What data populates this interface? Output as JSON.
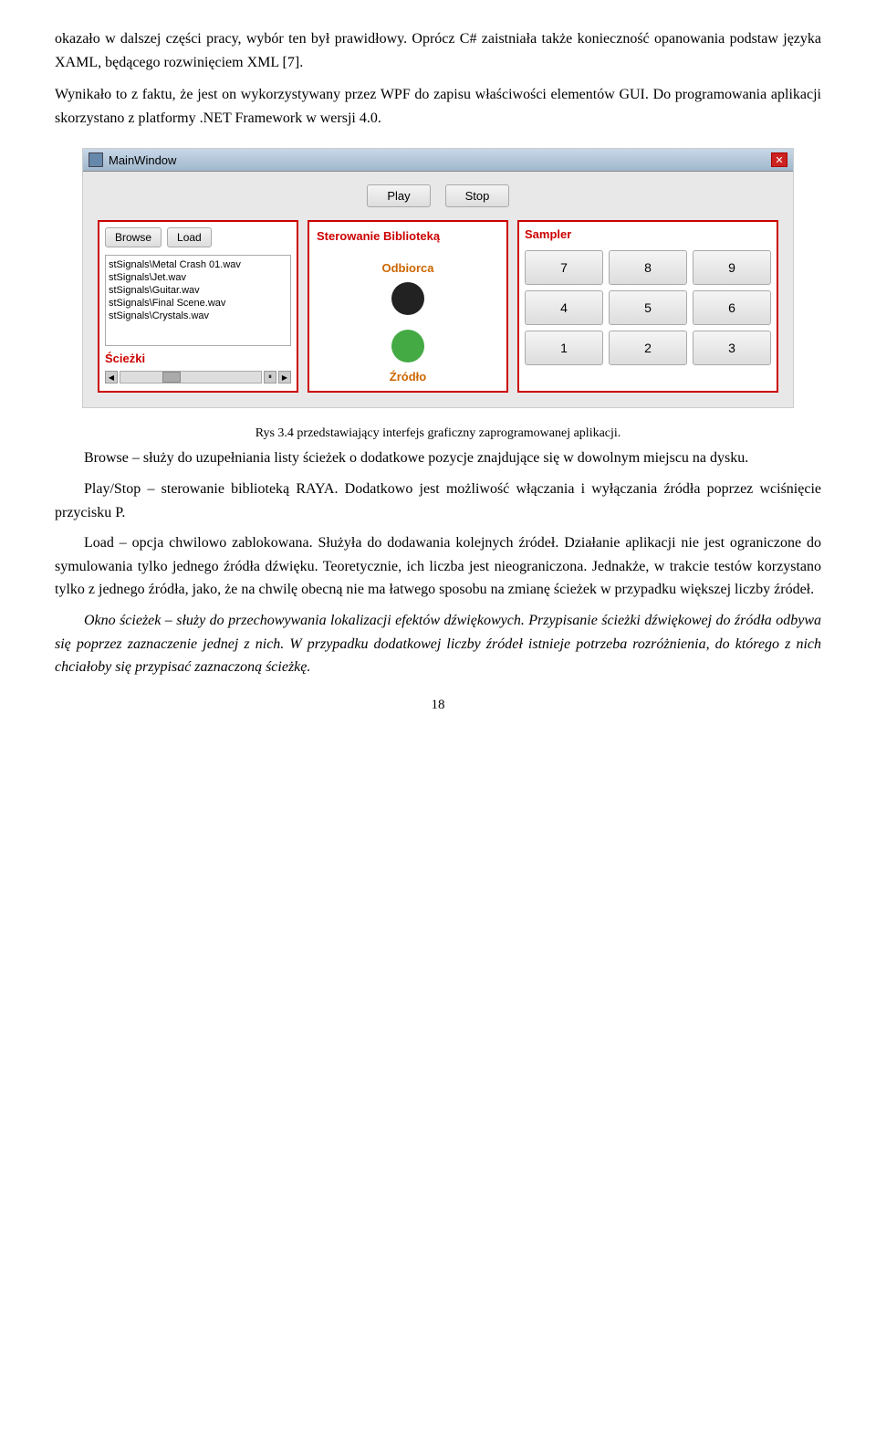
{
  "paragraphs": [
    {
      "id": "p1",
      "text": "okazało w dalszej części pracy, wybór ten był prawidłowy. Oprócz C# zaistniała także konieczność opanowania podstaw języka XAML, będącego rozwinięciem XML [7]."
    },
    {
      "id": "p2",
      "text": "Wynikało to z faktu, że jest on wykorzystywany przez WPF do zapisu właściwości elementów GUI. Do programowania aplikacji skorzystano z platformy .NET Framework w wersji 4.0."
    }
  ],
  "window": {
    "title": "MainWindow",
    "close_label": "✕",
    "play_label": "Play",
    "stop_label": "Stop",
    "browse_label": "Browse",
    "load_label": "Load",
    "sterowanie_label": "Sterowanie Biblioteką",
    "sampler_label": "Sampler",
    "odbiorca_label": "Odbiorca",
    "zrodlo_label": "Źródło",
    "sciezki_label": "Ścieżki",
    "files": [
      "stSignals\\Metal Crash 01.wav",
      "stSignals\\Jet.wav",
      "stSignals\\Guitar.wav",
      "stSignals\\Final Scene.wav",
      "stSignals\\Crystals.wav"
    ],
    "sampler_buttons": [
      "7",
      "8",
      "9",
      "4",
      "5",
      "6",
      "1",
      "2",
      "3"
    ]
  },
  "caption": "Rys 3.4 przedstawiający interfejs graficzny zaprogramowanej aplikacji.",
  "body_paragraphs": [
    {
      "id": "bp1",
      "indent": true,
      "text": "Browse – służy do uzupełniania listy ścieżek o dodatkowe pozycje znajdujące się w dowolnym miejscu na dysku."
    },
    {
      "id": "bp2",
      "indent": true,
      "text": "Play/Stop – sterowanie biblioteką RAYA. Dodatkowo jest możliwość włączania i wyłączania źródła poprzez wciśnięcie przycisku P."
    },
    {
      "id": "bp3",
      "indent": true,
      "text": "Load – opcja chwilowo zablokowana. Służyła do dodawania kolejnych źródeł. Działanie aplikacji nie jest ograniczone do symulowania tylko jednego źródła dźwięku. Teoretycznie, ich liczba jest nieograniczona. Jednakże, w trakcie testów korzystano tylko z jednego źródła, jako, że na chwilę obecną nie ma łatwego sposobu na zmianę ścieżek w przypadku większej liczby źródeł."
    },
    {
      "id": "bp4",
      "indent": true,
      "italic": true,
      "text": "Okno ścieżek – służy do przechowywania lokalizacji efektów dźwiękowych. Przypisanie ścieżki dźwiękowej do źródła odbywa się poprzez zaznaczenie jednej z nich. W przypadku dodatkowej liczby źródeł istnieje potrzeba rozróżnienia, do którego z nich chciałoby się przypisać zaznaczoną ścieżkę."
    }
  ],
  "page_number": "18"
}
